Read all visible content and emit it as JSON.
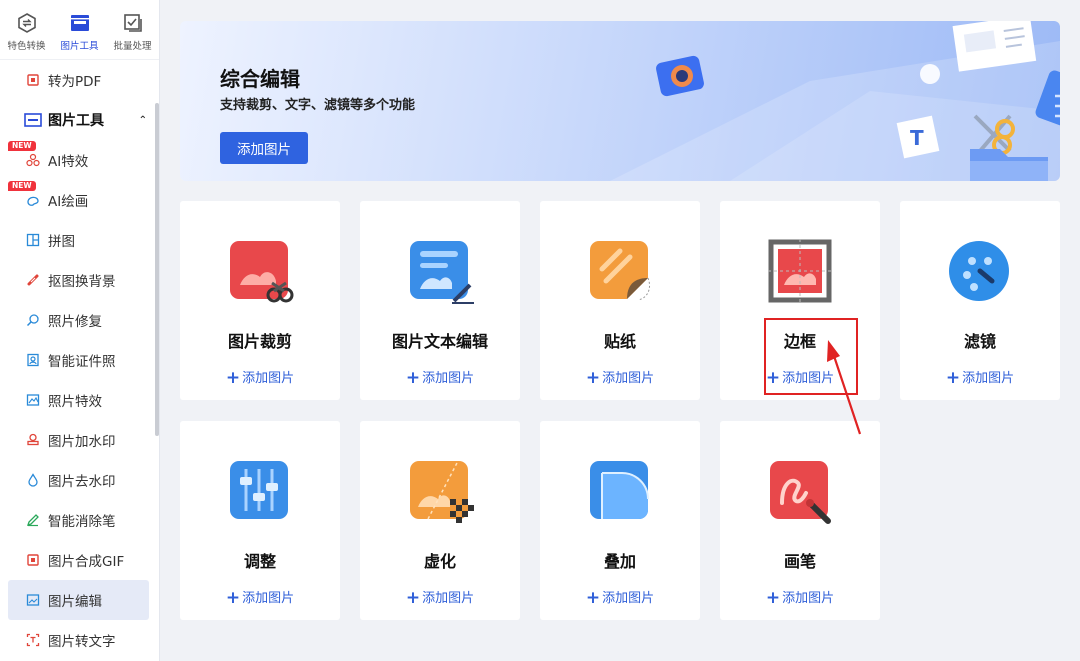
{
  "sidebar": {
    "top_tabs": [
      {
        "label": "特色转换",
        "icon": "convert-icon"
      },
      {
        "label": "图片工具",
        "icon": "image-tool-icon"
      },
      {
        "label": "批量处理",
        "icon": "batch-icon"
      }
    ],
    "items": [
      {
        "label": "转为PDF"
      },
      {
        "label": "图片工具"
      },
      {
        "label": "AI特效",
        "badge": "NEW"
      },
      {
        "label": "AI绘画",
        "badge": "NEW"
      },
      {
        "label": "拼图"
      },
      {
        "label": "抠图换背景"
      },
      {
        "label": "照片修复"
      },
      {
        "label": "智能证件照"
      },
      {
        "label": "照片特效"
      },
      {
        "label": "图片加水印"
      },
      {
        "label": "图片去水印"
      },
      {
        "label": "智能消除笔"
      },
      {
        "label": "图片合成GIF"
      },
      {
        "label": "图片编辑"
      },
      {
        "label": "图片转文字"
      }
    ]
  },
  "banner": {
    "title": "综合编辑",
    "subtitle": "支持裁剪、文字、滤镜等多个功能",
    "button": "添加图片"
  },
  "tools": [
    {
      "name": "图片裁剪",
      "add": "添加图片"
    },
    {
      "name": "图片文本编辑",
      "add": "添加图片"
    },
    {
      "name": "贴纸",
      "add": "添加图片"
    },
    {
      "name": "边框",
      "add": "添加图片"
    },
    {
      "name": "滤镜",
      "add": "添加图片"
    },
    {
      "name": "调整",
      "add": "添加图片"
    },
    {
      "name": "虚化",
      "add": "添加图片"
    },
    {
      "name": "叠加",
      "add": "添加图片"
    },
    {
      "name": "画笔",
      "add": "添加图片"
    }
  ],
  "colors": {
    "accent": "#2f63e0",
    "highlight": "#e02323",
    "active_nav": "#e5eaf7"
  }
}
